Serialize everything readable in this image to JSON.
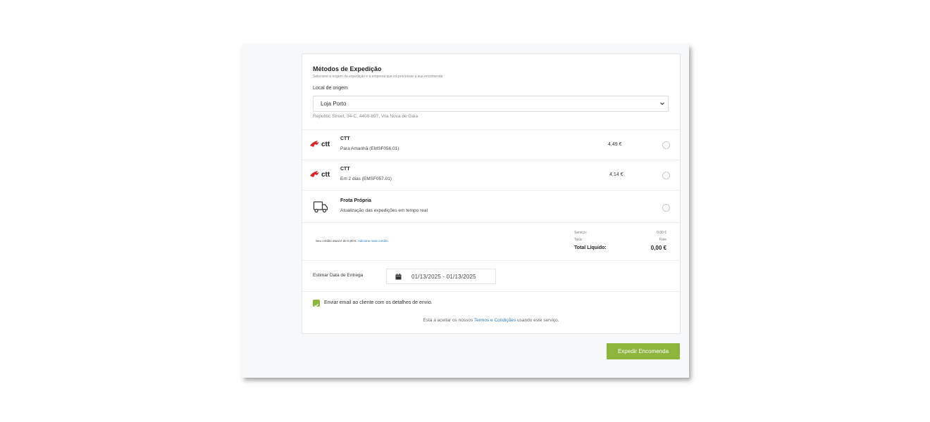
{
  "header": {
    "title": "Métodos de Expedição",
    "subtitle": "Selecione a origem da expedição e a empresa que irá processar a sua encomenda"
  },
  "origin": {
    "label": "Local de origem",
    "selected": "Loja Porto",
    "address": "Republic Street, 34-C, 4400-897, Vila Nova de Gaia"
  },
  "shipping_options": [
    {
      "logo": "ctt",
      "carrier": "CTT",
      "service": "Para Amanhã (EMSF056.01)",
      "price": "4,49 €",
      "selected": false
    },
    {
      "logo": "ctt",
      "carrier": "CTT",
      "service": "Em 2 dias (EMSF057.01)",
      "price": "4,14 €",
      "selected": false
    },
    {
      "icon": "truck-icon",
      "carrier": "Frota Própria",
      "service": "Atualização das expedições em tempo real",
      "price": "",
      "selected": false
    }
  ],
  "credit": {
    "text": "Seu crédito atual é de 0,00 €.",
    "link": "Adicione mais crédito."
  },
  "summary": {
    "service_label": "Serviço:",
    "service_value": "0,00 €",
    "tax_label": "Taxa:",
    "tax_value": "Free",
    "total_label": "Total Líquido:",
    "total_value": "0,00 €"
  },
  "delivery": {
    "label": "Estimar Data de Entrega",
    "range": "01/13/2025   - 01/13/2025"
  },
  "email": {
    "checked": true,
    "label": "Enviar email ao cliente com os detalhes de envio."
  },
  "terms": {
    "before": "Está a aceitar os nossos",
    "link": "Termos e Condições",
    "after": "usando este serviço."
  },
  "actions": {
    "submit": "Expedir Encomenda"
  },
  "colors": {
    "accent": "#8bb53d",
    "link": "#2a7ab8",
    "ctt_red": "#d9262a"
  }
}
